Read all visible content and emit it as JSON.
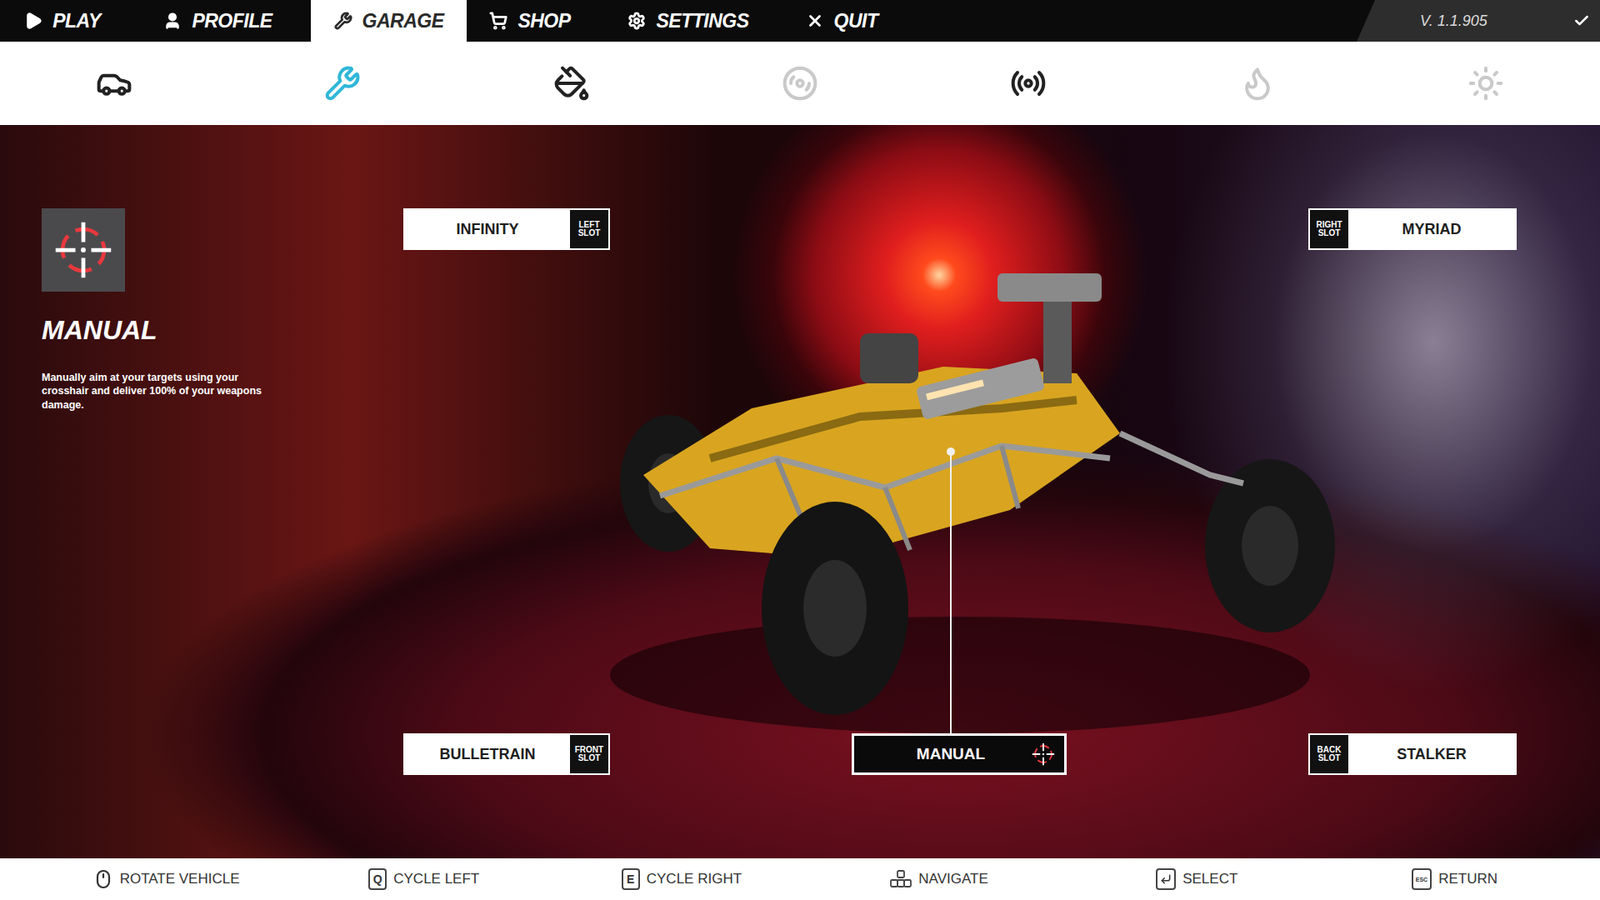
{
  "nav": {
    "items": [
      {
        "label": "PLAY",
        "selected": false
      },
      {
        "label": "PROFILE",
        "selected": false
      },
      {
        "label": "GARAGE",
        "selected": true
      },
      {
        "label": "SHOP",
        "selected": false
      },
      {
        "label": "SETTINGS",
        "selected": false
      },
      {
        "label": "QUIT",
        "selected": false
      }
    ],
    "version": "V. 1.1.905"
  },
  "categories": [
    {
      "selected": false,
      "disabled": false
    },
    {
      "selected": true,
      "disabled": false
    },
    {
      "selected": false,
      "disabled": false
    },
    {
      "selected": false,
      "disabled": true
    },
    {
      "selected": false,
      "disabled": false
    },
    {
      "selected": false,
      "disabled": true
    },
    {
      "selected": false,
      "disabled": true
    }
  ],
  "info": {
    "title": "MANUAL",
    "description": "Manually aim at your targets using your crosshair and deliver 100% of your weapons damage."
  },
  "slots": [
    {
      "name": "INFINITY",
      "tag": "LEFT SLOT"
    },
    {
      "name": "MYRIAD",
      "tag": "RIGHT SLOT"
    },
    {
      "name": "BULLETRAIN",
      "tag": "FRONT SLOT"
    },
    {
      "name": "STALKER",
      "tag": "BACK SLOT"
    }
  ],
  "aim_mode": {
    "label": "MANUAL",
    "selected": true
  },
  "hints": [
    {
      "kind": "mouse",
      "label": "ROTATE VEHICLE"
    },
    {
      "kind": "key",
      "key": "Q",
      "label": "CYCLE LEFT"
    },
    {
      "kind": "key",
      "key": "E",
      "label": "CYCLE RIGHT"
    },
    {
      "kind": "navigate",
      "label": "NAVIGATE"
    },
    {
      "kind": "enter",
      "label": "SELECT"
    },
    {
      "kind": "key",
      "key": "ESC",
      "label": "RETURN"
    }
  ]
}
